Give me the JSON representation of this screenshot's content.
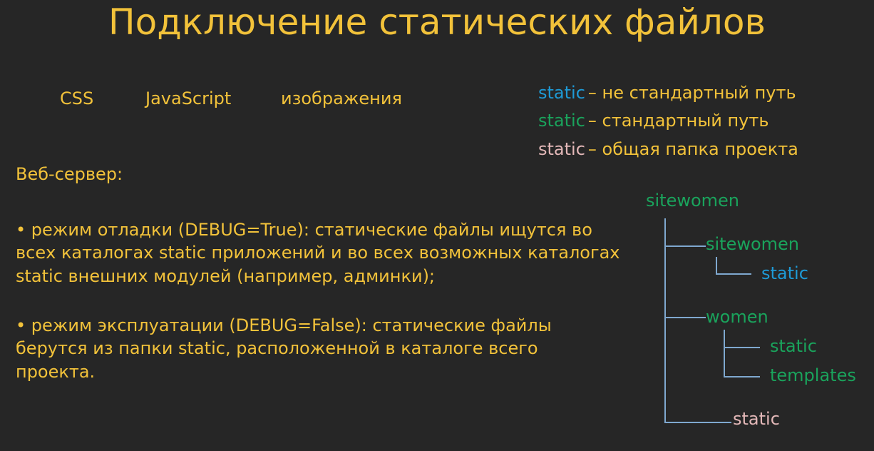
{
  "title": "Подключение статических файлов",
  "topics": [
    "CSS",
    "JavaScript",
    "изображения"
  ],
  "legend": [
    {
      "keyword": "static",
      "text": "– не стандартный путь"
    },
    {
      "keyword": "static",
      "text": "– стандартный путь"
    },
    {
      "keyword": "static",
      "text": "– общая папка проекта"
    }
  ],
  "colors": {
    "background": "#262626",
    "yellow": "#f2c23a",
    "blue": "#1e9ad6",
    "green": "#1aa35c",
    "pink": "#e3b8b8",
    "tree_line": "#7fa8cf"
  },
  "webserver_label": "Веб-сервер:",
  "paragraphs": [
    "• режим отладки (DEBUG=True): статические файлы ищутся во всех каталогах static приложений и во всех возможных каталогах static внешних модулей (например, админки);",
    "• режим эксплуатации (DEBUG=False): статические файлы берутся из папки static, расположенной в каталоге всего проекта."
  ],
  "tree": {
    "root": "sitewomen",
    "sitewomen_app": "sitewomen",
    "sitewomen_static": "static",
    "women_app": "women",
    "women_static": "static",
    "women_templates": "templates",
    "project_static": "static"
  }
}
